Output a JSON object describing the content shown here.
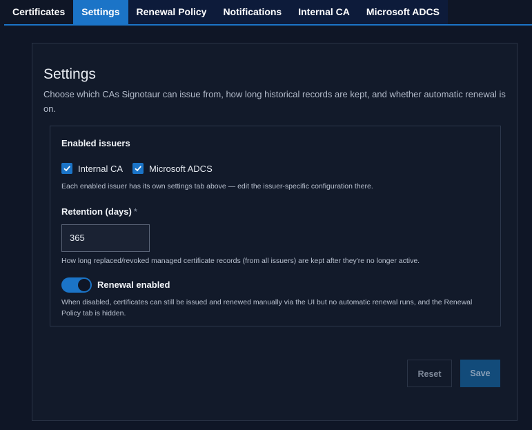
{
  "tabs": [
    {
      "label": "Certificates",
      "active": false
    },
    {
      "label": "Settings",
      "active": true
    },
    {
      "label": "Renewal Policy",
      "active": false
    },
    {
      "label": "Notifications",
      "active": false
    },
    {
      "label": "Internal CA",
      "active": false
    },
    {
      "label": "Microsoft ADCS",
      "active": false
    }
  ],
  "settings": {
    "title": "Settings",
    "description": "Choose which CAs Signotaur can issue from, how long historical records are kept, and whether automatic renewal is on.",
    "issuers": {
      "heading": "Enabled issuers",
      "options": [
        {
          "label": "Internal CA",
          "checked": true
        },
        {
          "label": "Microsoft ADCS",
          "checked": true
        }
      ],
      "help": "Each enabled issuer has its own settings tab above — edit the issuer-specific configuration there."
    },
    "retention": {
      "label": "Retention (days)",
      "required_mark": "*",
      "value": "365",
      "help": "How long replaced/revoked managed certificate records (from all issuers) are kept after they're no longer active."
    },
    "renewal": {
      "label": "Renewal enabled",
      "enabled": true,
      "help": "When disabled, certificates can still be issued and renewed manually via the UI but no automatic renewal runs, and the Renewal Policy tab is hidden."
    }
  },
  "actions": {
    "reset_label": "Reset",
    "save_label": "Save"
  },
  "colors": {
    "accent": "#1b74c7",
    "background": "#0f1626",
    "tab_inactive": "#0d1b3a"
  },
  "icons": {
    "checkbox": "check-icon"
  }
}
